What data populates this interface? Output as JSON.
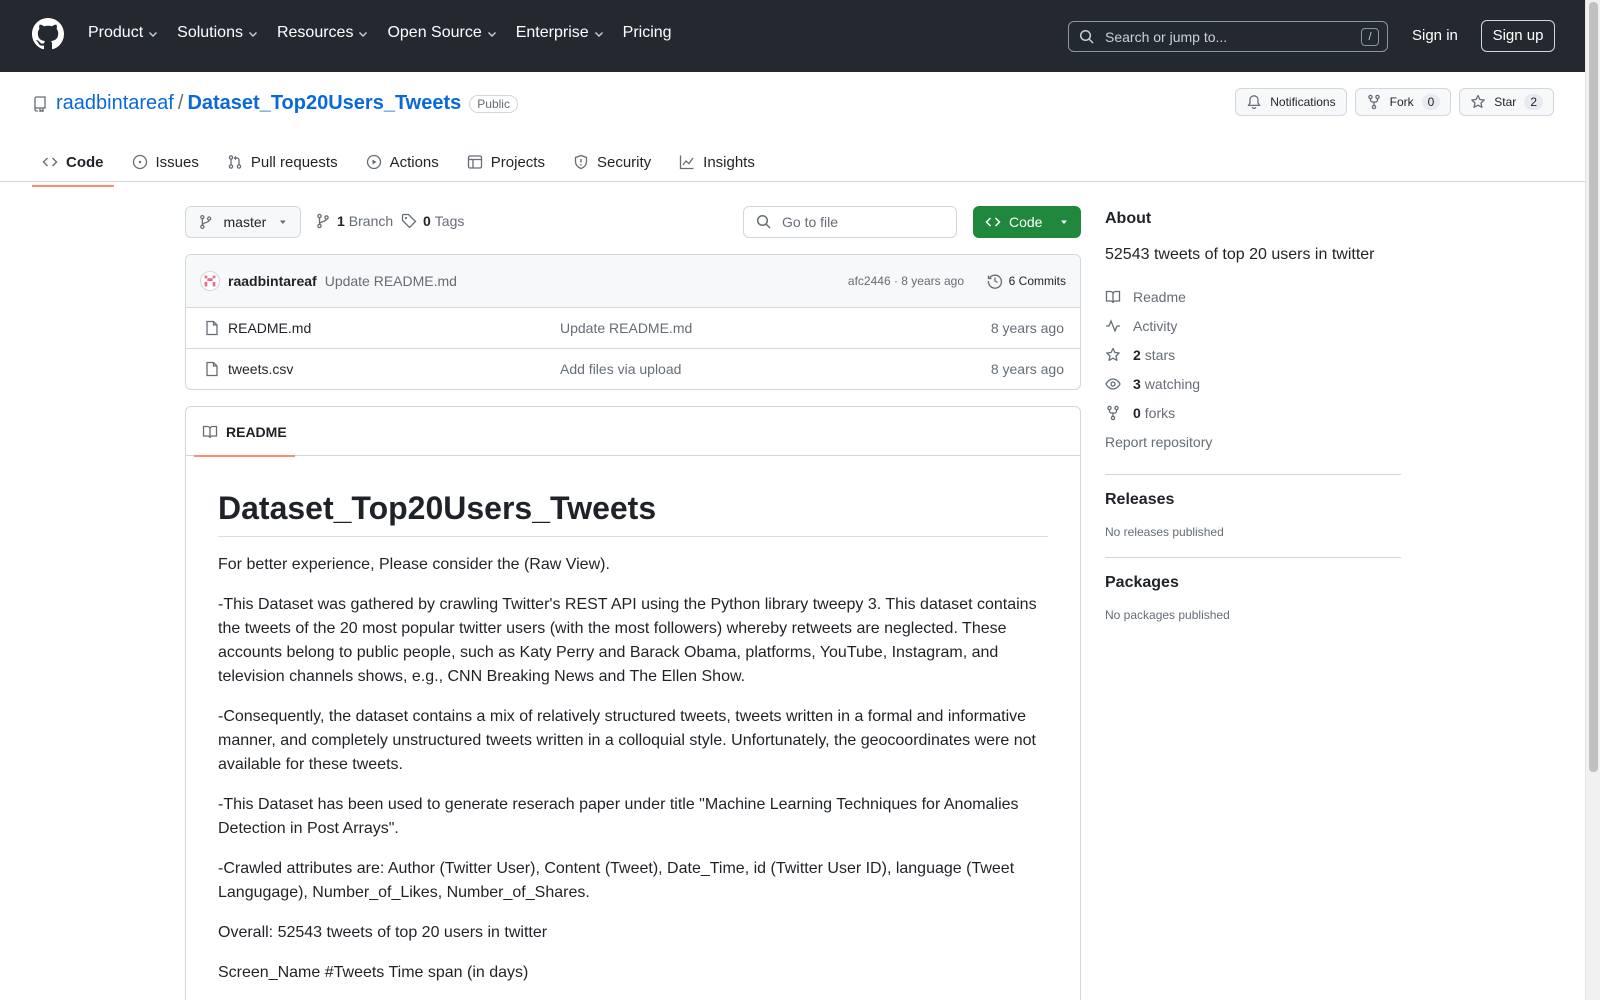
{
  "header": {
    "nav": [
      "Product",
      "Solutions",
      "Resources",
      "Open Source",
      "Enterprise",
      "Pricing"
    ],
    "search_placeholder": "Search or jump to...",
    "search_shortcut": "/",
    "sign_in": "Sign in",
    "sign_up": "Sign up"
  },
  "repo": {
    "owner": "raadbintareaf",
    "separator": "/",
    "name": "Dataset_Top20Users_Tweets",
    "visibility": "Public",
    "actions": {
      "notifications": "Notifications",
      "fork": "Fork",
      "fork_count": "0",
      "star": "Star",
      "star_count": "2"
    },
    "tabs": [
      "Code",
      "Issues",
      "Pull requests",
      "Actions",
      "Projects",
      "Security",
      "Insights"
    ]
  },
  "file_nav": {
    "branch": "master",
    "branch_count": "1",
    "branch_label": "Branch",
    "tag_count": "0",
    "tag_label": "Tags",
    "goto_placeholder": "Go to file",
    "code_button": "Code"
  },
  "latest_commit": {
    "author": "raadbintareaf",
    "message": "Update README.md",
    "sha_time": "afc2446 · 8 years ago",
    "commits": "6 Commits"
  },
  "files": [
    {
      "name": "README.md",
      "message": "Update README.md",
      "date": "8 years ago"
    },
    {
      "name": "tweets.csv",
      "message": "Add files via upload",
      "date": "8 years ago"
    }
  ],
  "readme": {
    "tab": "README",
    "title": "Dataset_Top20Users_Tweets",
    "paragraphs": [
      "For better experience, Please consider the (Raw View).",
      "-This Dataset was gathered by crawling Twitter's REST API using the Python library tweepy 3. This dataset contains the tweets of the 20 most popular twitter users (with the most followers) whereby retweets are neglected. These accounts belong to public people, such as Katy Perry and Barack Obama, platforms, YouTube, Instagram, and television channels shows, e.g., CNN Breaking News and The Ellen Show.",
      "-Consequently, the dataset contains a mix of relatively structured tweets, tweets written in a formal and informative manner, and completely unstructured tweets written in a colloquial style. Unfortunately, the geocoordinates were not available for these tweets.",
      "-This Dataset has been used to generate reserach paper under title \"Machine Learning Techniques for Anomalies Detection in Post Arrays\".",
      "-Crawled attributes are: Author (Twitter User), Content (Tweet), Date_Time, id (Twitter User ID), language (Tweet Langugage), Number_of_Likes, Number_of_Shares.",
      "Overall: 52543 tweets of top 20 users in twitter",
      "Screen_Name #Tweets Time span (in days)"
    ]
  },
  "about": {
    "heading": "About",
    "description": "52543 tweets of top 20 users in twitter",
    "readme": "Readme",
    "activity": "Activity",
    "stars_count": "2",
    "stars_label": "stars",
    "watching_count": "3",
    "watching_label": "watching",
    "forks_count": "0",
    "forks_label": "forks",
    "report": "Report repository"
  },
  "releases": {
    "heading": "Releases",
    "empty": "No releases published"
  },
  "packages": {
    "heading": "Packages",
    "empty": "No packages published"
  },
  "colors": {
    "header_bg": "#24292f",
    "link": "#0969da",
    "primary_button": "#1f883d",
    "active_tab_underline": "#fd8c73"
  }
}
